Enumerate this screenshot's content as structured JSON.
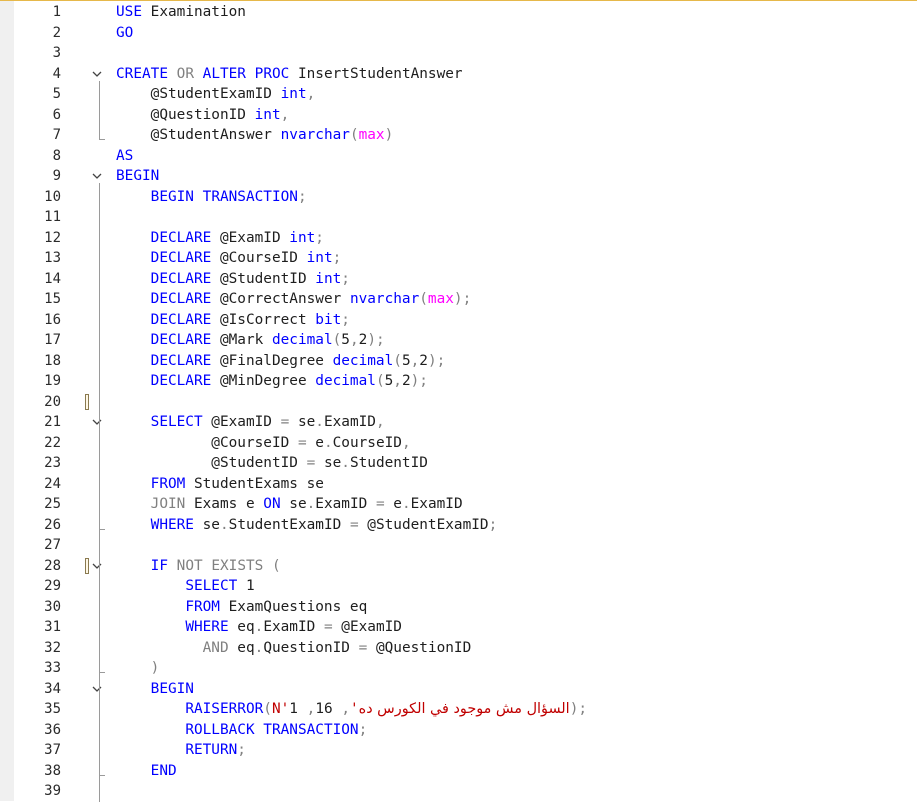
{
  "editor": {
    "lines": [
      {
        "n": "1",
        "tokens": [
          {
            "t": "USE",
            "c": "kw"
          },
          {
            "t": " Examination",
            "c": ""
          }
        ]
      },
      {
        "n": "2",
        "tokens": [
          {
            "t": "GO",
            "c": "kw"
          }
        ]
      },
      {
        "n": "3",
        "tokens": []
      },
      {
        "n": "4",
        "fold": true,
        "tokens": [
          {
            "t": "CREATE",
            "c": "kw"
          },
          {
            "t": " ",
            "c": ""
          },
          {
            "t": "OR",
            "c": "gr"
          },
          {
            "t": " ",
            "c": ""
          },
          {
            "t": "ALTER",
            "c": "kw"
          },
          {
            "t": " ",
            "c": ""
          },
          {
            "t": "PROC",
            "c": "kw"
          },
          {
            "t": " InsertStudentAnswer",
            "c": ""
          }
        ]
      },
      {
        "n": "5",
        "tokens": [
          {
            "t": "    @StudentExamID ",
            "c": ""
          },
          {
            "t": "int",
            "c": "ty"
          },
          {
            "t": ",",
            "c": "gr"
          }
        ]
      },
      {
        "n": "6",
        "tokens": [
          {
            "t": "    @QuestionID ",
            "c": ""
          },
          {
            "t": "int",
            "c": "ty"
          },
          {
            "t": ",",
            "c": "gr"
          }
        ]
      },
      {
        "n": "7",
        "tokens": [
          {
            "t": "    @StudentAnswer ",
            "c": ""
          },
          {
            "t": "nvarchar",
            "c": "ty"
          },
          {
            "t": "(",
            "c": "gr"
          },
          {
            "t": "max",
            "c": "fn"
          },
          {
            "t": ")",
            "c": "gr"
          }
        ]
      },
      {
        "n": "8",
        "tokens": [
          {
            "t": "AS",
            "c": "kw"
          }
        ]
      },
      {
        "n": "9",
        "fold": true,
        "tokens": [
          {
            "t": "BEGIN",
            "c": "kw"
          }
        ]
      },
      {
        "n": "10",
        "tokens": [
          {
            "t": "    ",
            "c": ""
          },
          {
            "t": "BEGIN",
            "c": "kw"
          },
          {
            "t": " ",
            "c": ""
          },
          {
            "t": "TRANSACTION",
            "c": "kw"
          },
          {
            "t": ";",
            "c": "gr"
          }
        ]
      },
      {
        "n": "11",
        "tokens": []
      },
      {
        "n": "12",
        "tokens": [
          {
            "t": "    ",
            "c": ""
          },
          {
            "t": "DECLARE",
            "c": "kw"
          },
          {
            "t": " @ExamID ",
            "c": ""
          },
          {
            "t": "int",
            "c": "ty"
          },
          {
            "t": ";",
            "c": "gr"
          }
        ]
      },
      {
        "n": "13",
        "tokens": [
          {
            "t": "    ",
            "c": ""
          },
          {
            "t": "DECLARE",
            "c": "kw"
          },
          {
            "t": " @CourseID ",
            "c": ""
          },
          {
            "t": "int",
            "c": "ty"
          },
          {
            "t": ";",
            "c": "gr"
          }
        ]
      },
      {
        "n": "14",
        "tokens": [
          {
            "t": "    ",
            "c": ""
          },
          {
            "t": "DECLARE",
            "c": "kw"
          },
          {
            "t": " @StudentID ",
            "c": ""
          },
          {
            "t": "int",
            "c": "ty"
          },
          {
            "t": ";",
            "c": "gr"
          }
        ]
      },
      {
        "n": "15",
        "tokens": [
          {
            "t": "    ",
            "c": ""
          },
          {
            "t": "DECLARE",
            "c": "kw"
          },
          {
            "t": " @CorrectAnswer ",
            "c": ""
          },
          {
            "t": "nvarchar",
            "c": "ty"
          },
          {
            "t": "(",
            "c": "gr"
          },
          {
            "t": "max",
            "c": "fn"
          },
          {
            "t": ");",
            "c": "gr"
          }
        ]
      },
      {
        "n": "16",
        "tokens": [
          {
            "t": "    ",
            "c": ""
          },
          {
            "t": "DECLARE",
            "c": "kw"
          },
          {
            "t": " @IsCorrect ",
            "c": ""
          },
          {
            "t": "bit",
            "c": "ty"
          },
          {
            "t": ";",
            "c": "gr"
          }
        ]
      },
      {
        "n": "17",
        "tokens": [
          {
            "t": "    ",
            "c": ""
          },
          {
            "t": "DECLARE",
            "c": "kw"
          },
          {
            "t": " @Mark ",
            "c": ""
          },
          {
            "t": "decimal",
            "c": "ty"
          },
          {
            "t": "(",
            "c": "gr"
          },
          {
            "t": "5",
            "c": ""
          },
          {
            "t": ",",
            "c": "gr"
          },
          {
            "t": "2",
            "c": ""
          },
          {
            "t": ");",
            "c": "gr"
          }
        ]
      },
      {
        "n": "18",
        "tokens": [
          {
            "t": "    ",
            "c": ""
          },
          {
            "t": "DECLARE",
            "c": "kw"
          },
          {
            "t": " @FinalDegree ",
            "c": ""
          },
          {
            "t": "decimal",
            "c": "ty"
          },
          {
            "t": "(",
            "c": "gr"
          },
          {
            "t": "5",
            "c": ""
          },
          {
            "t": ",",
            "c": "gr"
          },
          {
            "t": "2",
            "c": ""
          },
          {
            "t": ");",
            "c": "gr"
          }
        ]
      },
      {
        "n": "19",
        "tokens": [
          {
            "t": "    ",
            "c": ""
          },
          {
            "t": "DECLARE",
            "c": "kw"
          },
          {
            "t": " @MinDegree ",
            "c": ""
          },
          {
            "t": "decimal",
            "c": "ty"
          },
          {
            "t": "(",
            "c": "gr"
          },
          {
            "t": "5",
            "c": ""
          },
          {
            "t": ",",
            "c": "gr"
          },
          {
            "t": "2",
            "c": ""
          },
          {
            "t": ");",
            "c": "gr"
          }
        ]
      },
      {
        "n": "20",
        "mark": true,
        "tokens": []
      },
      {
        "n": "21",
        "fold": true,
        "tokens": [
          {
            "t": "    ",
            "c": ""
          },
          {
            "t": "SELECT",
            "c": "kw"
          },
          {
            "t": " @ExamID ",
            "c": ""
          },
          {
            "t": "=",
            "c": "gr"
          },
          {
            "t": " se",
            "c": ""
          },
          {
            "t": ".",
            "c": "gr"
          },
          {
            "t": "ExamID",
            "c": ""
          },
          {
            "t": ",",
            "c": "gr"
          }
        ]
      },
      {
        "n": "22",
        "tokens": [
          {
            "t": "           @CourseID ",
            "c": ""
          },
          {
            "t": "=",
            "c": "gr"
          },
          {
            "t": " e",
            "c": ""
          },
          {
            "t": ".",
            "c": "gr"
          },
          {
            "t": "CourseID",
            "c": ""
          },
          {
            "t": ",",
            "c": "gr"
          }
        ]
      },
      {
        "n": "23",
        "tokens": [
          {
            "t": "           @StudentID ",
            "c": ""
          },
          {
            "t": "=",
            "c": "gr"
          },
          {
            "t": " se",
            "c": ""
          },
          {
            "t": ".",
            "c": "gr"
          },
          {
            "t": "StudentID",
            "c": ""
          }
        ]
      },
      {
        "n": "24",
        "tokens": [
          {
            "t": "    ",
            "c": ""
          },
          {
            "t": "FROM",
            "c": "kw"
          },
          {
            "t": " StudentExams se",
            "c": ""
          }
        ]
      },
      {
        "n": "25",
        "tokens": [
          {
            "t": "    ",
            "c": ""
          },
          {
            "t": "JOIN",
            "c": "gr"
          },
          {
            "t": " Exams e ",
            "c": ""
          },
          {
            "t": "ON",
            "c": "kw"
          },
          {
            "t": " se",
            "c": ""
          },
          {
            "t": ".",
            "c": "gr"
          },
          {
            "t": "ExamID ",
            "c": ""
          },
          {
            "t": "=",
            "c": "gr"
          },
          {
            "t": " e",
            "c": ""
          },
          {
            "t": ".",
            "c": "gr"
          },
          {
            "t": "ExamID",
            "c": ""
          }
        ]
      },
      {
        "n": "26",
        "tokens": [
          {
            "t": "    ",
            "c": ""
          },
          {
            "t": "WHERE",
            "c": "kw"
          },
          {
            "t": " se",
            "c": ""
          },
          {
            "t": ".",
            "c": "gr"
          },
          {
            "t": "StudentExamID ",
            "c": ""
          },
          {
            "t": "=",
            "c": "gr"
          },
          {
            "t": " @StudentExamID",
            "c": ""
          },
          {
            "t": ";",
            "c": "gr"
          }
        ]
      },
      {
        "n": "27",
        "tokens": []
      },
      {
        "n": "28",
        "fold": true,
        "mark": true,
        "tokens": [
          {
            "t": "    ",
            "c": ""
          },
          {
            "t": "IF",
            "c": "kw"
          },
          {
            "t": " ",
            "c": ""
          },
          {
            "t": "NOT",
            "c": "gr"
          },
          {
            "t": " ",
            "c": ""
          },
          {
            "t": "EXISTS",
            "c": "gr"
          },
          {
            "t": " (",
            "c": "gr"
          }
        ]
      },
      {
        "n": "29",
        "tokens": [
          {
            "t": "        ",
            "c": ""
          },
          {
            "t": "SELECT",
            "c": "kw"
          },
          {
            "t": " 1",
            "c": ""
          }
        ]
      },
      {
        "n": "30",
        "tokens": [
          {
            "t": "        ",
            "c": ""
          },
          {
            "t": "FROM",
            "c": "kw"
          },
          {
            "t": " ExamQuestions eq",
            "c": ""
          }
        ]
      },
      {
        "n": "31",
        "tokens": [
          {
            "t": "        ",
            "c": ""
          },
          {
            "t": "WHERE",
            "c": "kw"
          },
          {
            "t": " eq",
            "c": ""
          },
          {
            "t": ".",
            "c": "gr"
          },
          {
            "t": "ExamID ",
            "c": ""
          },
          {
            "t": "=",
            "c": "gr"
          },
          {
            "t": " @ExamID",
            "c": ""
          }
        ]
      },
      {
        "n": "32",
        "tokens": [
          {
            "t": "          ",
            "c": ""
          },
          {
            "t": "AND",
            "c": "gr"
          },
          {
            "t": " eq",
            "c": ""
          },
          {
            "t": ".",
            "c": "gr"
          },
          {
            "t": "QuestionID ",
            "c": ""
          },
          {
            "t": "=",
            "c": "gr"
          },
          {
            "t": " @QuestionID",
            "c": ""
          }
        ]
      },
      {
        "n": "33",
        "tokens": [
          {
            "t": "    ",
            "c": ""
          },
          {
            "t": ")",
            "c": "gr"
          }
        ]
      },
      {
        "n": "34",
        "fold": true,
        "tokens": [
          {
            "t": "    ",
            "c": ""
          },
          {
            "t": "BEGIN",
            "c": "kw"
          }
        ]
      },
      {
        "n": "35",
        "tokens": [
          {
            "t": "        ",
            "c": ""
          },
          {
            "t": "RAISERROR",
            "c": "kw"
          },
          {
            "t": "(",
            "c": "gr"
          },
          {
            "t": "N'",
            "c": "st"
          },
          {
            "t": "السؤال مش موجود في الكورس ده",
            "c": "ar"
          },
          {
            "t": "'",
            "c": "st"
          },
          {
            "t": ",",
            "c": "gr"
          },
          {
            "t": " 16",
            "c": ""
          },
          {
            "t": ",",
            "c": "gr"
          },
          {
            "t": " 1",
            "c": ""
          },
          {
            "t": ");",
            "c": "gr"
          }
        ]
      },
      {
        "n": "36",
        "tokens": [
          {
            "t": "        ",
            "c": ""
          },
          {
            "t": "ROLLBACK",
            "c": "kw"
          },
          {
            "t": " ",
            "c": ""
          },
          {
            "t": "TRANSACTION",
            "c": "kw"
          },
          {
            "t": ";",
            "c": "gr"
          }
        ]
      },
      {
        "n": "37",
        "tokens": [
          {
            "t": "        ",
            "c": ""
          },
          {
            "t": "RETURN",
            "c": "kw"
          },
          {
            "t": ";",
            "c": "gr"
          }
        ]
      },
      {
        "n": "38",
        "tokens": [
          {
            "t": "    ",
            "c": ""
          },
          {
            "t": "END",
            "c": "kw"
          }
        ]
      },
      {
        "n": "39",
        "tokens": []
      }
    ]
  }
}
